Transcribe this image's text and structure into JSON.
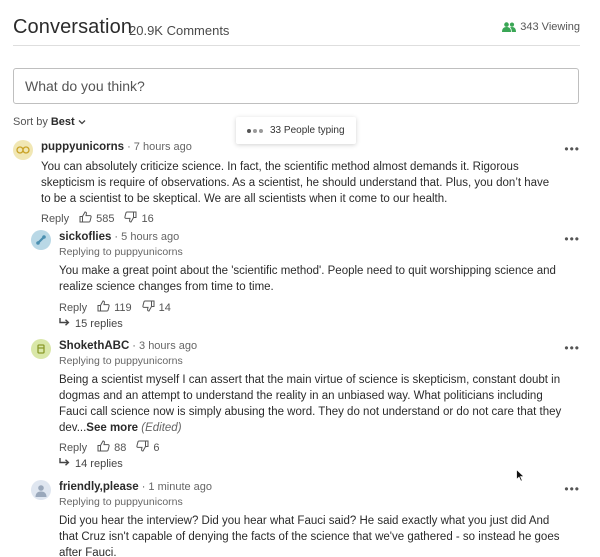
{
  "header": {
    "title": "Conversation",
    "comment_count": "20.9K Comments",
    "viewing": "343 Viewing"
  },
  "composer": {
    "placeholder": "What do you think?"
  },
  "sort": {
    "label": "Sort by",
    "value": "Best"
  },
  "typing": {
    "text": "33 People typing"
  },
  "comments": [
    {
      "author": "puppyunicorns",
      "time": "7 hours ago",
      "text": "You can absolutely criticize science. In fact, the scientific method almost demands it. Rigorous skepticism is require of observations. As a scientist, he should understand that. Plus, you don’t have to be a scientist to be skeptical. We are all scientists when it come to our health.",
      "reply_label": "Reply",
      "likes": "585",
      "dislikes": "16"
    },
    {
      "author": "sickoflies",
      "time": "5 hours ago",
      "replying_to": "Replying to puppyunicorns",
      "text": "You make a great point about the 'scientific method'. People need to quit worshipping science and realize science changes from time to time.",
      "reply_label": "Reply",
      "likes": "119",
      "dislikes": "14",
      "replies": "15 replies"
    },
    {
      "author": "ShokethABC",
      "time": "3 hours ago",
      "replying_to": "Replying to puppyunicorns",
      "text": "Being a scientist myself I can assert that the main virtue of science is skepticism, constant doubt in dogmas and an attempt to understand the reality in an unbiased way. What politicians including Fauci call science now is simply abusing the word. They do not understand or do not care that they dev...",
      "see_more": "See more",
      "edited": "(Edited)",
      "reply_label": "Reply",
      "likes": "88",
      "dislikes": "6",
      "replies": "14 replies"
    },
    {
      "author": "friendly,please",
      "time": "1 minute ago",
      "replying_to": "Replying to puppyunicorns",
      "text": "Did you hear the interview? Did you hear what Fauci said? He said exactly what you just did And that Cruz isn't capable of denying the facts of the science that we've gathered - so instead he goes after Fauci."
    }
  ],
  "colors": {
    "viewing_icon": "#3aa655",
    "avatar_1": "#f1e7b4",
    "avatar_2": "#b9d8e6",
    "avatar_3": "#d9e7a8",
    "avatar_4": "#dfe6f0"
  }
}
